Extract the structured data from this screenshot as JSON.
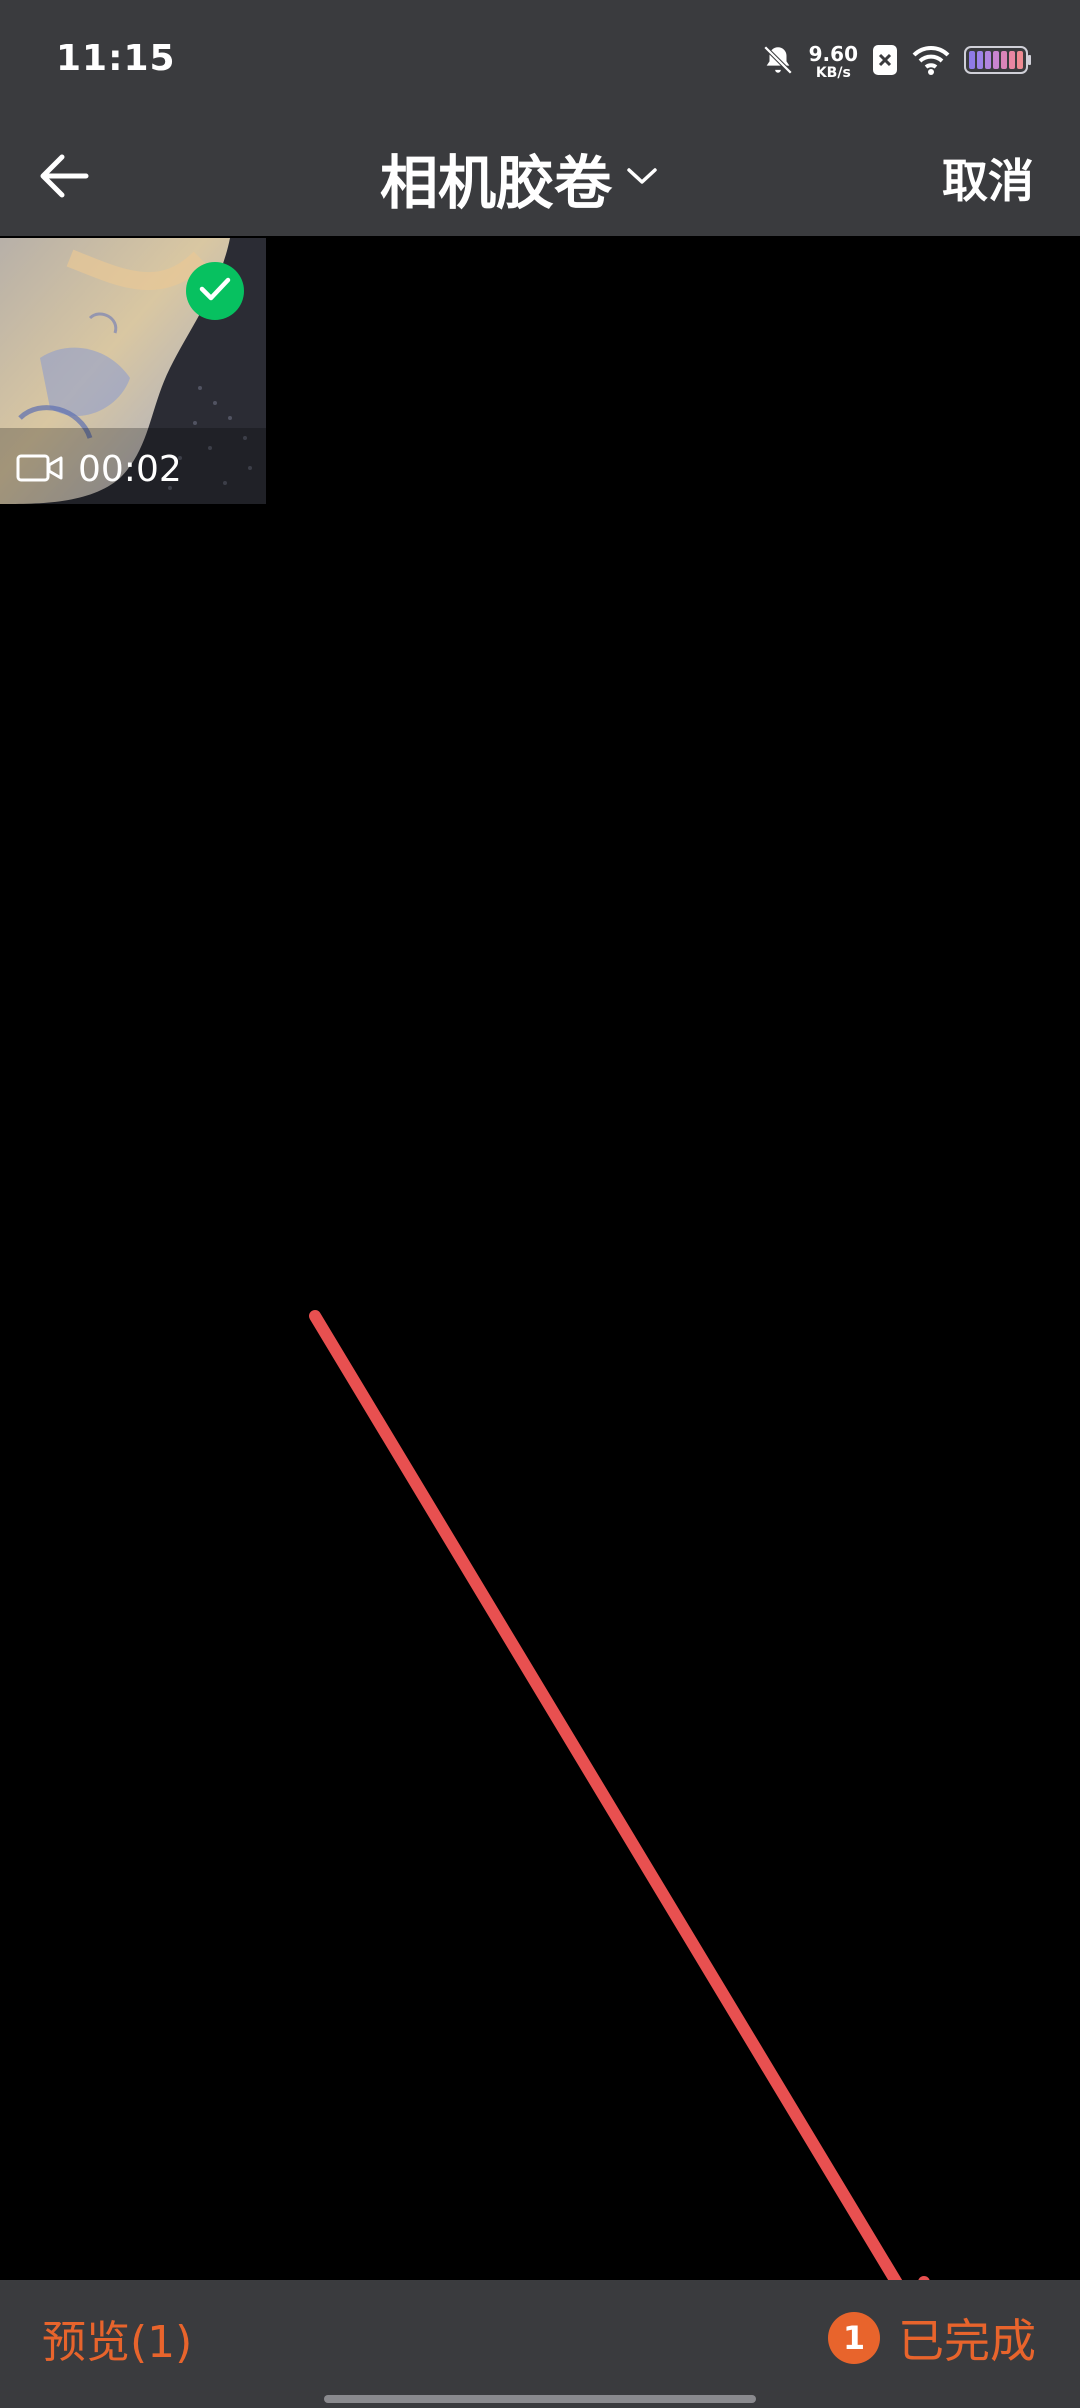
{
  "status_bar": {
    "time": "11:15",
    "net_speed_value": "9.60",
    "net_speed_unit": "KB/s",
    "icons": [
      "bell-muted-icon",
      "app-notification-icon",
      "wifi-icon",
      "battery-icon"
    ]
  },
  "title_bar": {
    "title": "相机胶卷",
    "back_icon": "arrow-left-icon",
    "dropdown_icon": "chevron-down-icon",
    "cancel_label": "取消"
  },
  "grid": {
    "items": [
      {
        "type": "video",
        "duration": "00:02",
        "selected": true,
        "icons": [
          "video-camera-icon",
          "check-icon"
        ]
      }
    ]
  },
  "bottom_bar": {
    "preview_label": "预览(1)",
    "selected_count": "1",
    "done_label": "已完成"
  },
  "colors": {
    "bar_background": "#3a3b3e",
    "accent_orange": "#e8642c",
    "check_green": "#07c160",
    "annotation_red": "#e85050"
  }
}
